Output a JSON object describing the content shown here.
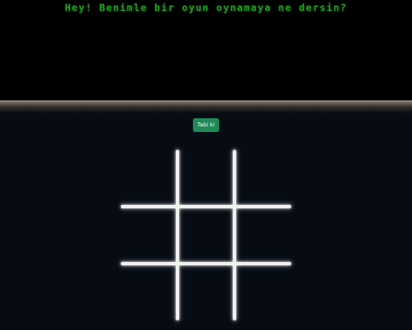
{
  "header": {
    "message": "Hey! Benimle bir oyun oynamaya ne dersin?"
  },
  "game": {
    "accept_label": "Tabi ki",
    "board": {
      "rows": 3,
      "cols": 3,
      "cells": [
        "",
        "",
        "",
        "",
        "",
        "",
        "",
        "",
        ""
      ]
    }
  },
  "colors": {
    "terminal_background": "#000000",
    "terminal_text": "#1aa01a",
    "game_background": "#070c14",
    "button_background": "#1f8a55",
    "grid_line": "#f0f0f0"
  }
}
